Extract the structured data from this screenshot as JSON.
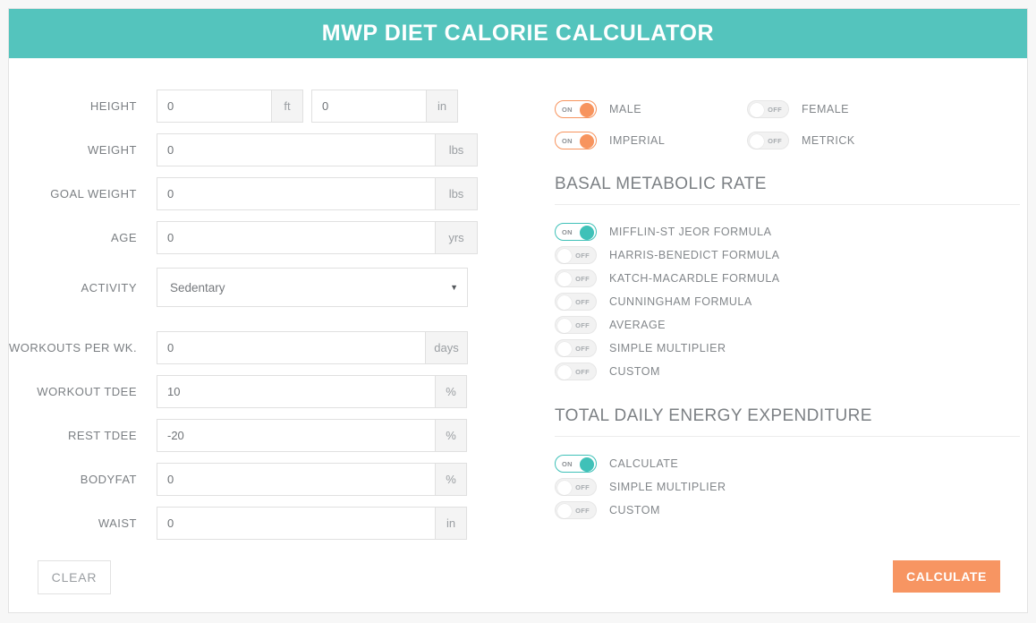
{
  "header": {
    "title": "MWP DIET CALORIE CALCULATOR"
  },
  "form": {
    "fields": [
      {
        "label": "HEIGHT",
        "value": "0",
        "suffix": "ft",
        "value2": "0",
        "suffix2": "in"
      },
      {
        "label": "WEIGHT",
        "value": "0",
        "suffix": "lbs"
      },
      {
        "label": "GOAL WEIGHT",
        "value": "0",
        "suffix": "lbs"
      },
      {
        "label": "AGE",
        "value": "0",
        "suffix": "yrs"
      },
      {
        "label": "ACTIVITY",
        "value": "Sedentary"
      },
      {
        "label": "WORKOUTS PER WK.",
        "value": "0",
        "suffix": "days"
      },
      {
        "label": "WORKOUT TDEE",
        "value": "10",
        "suffix": "%"
      },
      {
        "label": "REST TDEE",
        "value": "-20",
        "suffix": "%"
      },
      {
        "label": "BODYFAT",
        "value": "0",
        "suffix": "%"
      },
      {
        "label": "WAIST",
        "value": "0",
        "suffix": "in"
      }
    ],
    "activity_options": [
      "Sedentary"
    ],
    "select_arrow": "▼"
  },
  "toggles": {
    "on_text": "ON",
    "off_text": "OFF",
    "gender": [
      {
        "label": "MALE",
        "state": "on",
        "color": "#f7945e"
      },
      {
        "label": "FEMALE",
        "state": "off"
      }
    ],
    "units": [
      {
        "label": "IMPERIAL",
        "state": "on",
        "color": "#f7945e"
      },
      {
        "label": "METRICK",
        "state": "off"
      }
    ]
  },
  "bmr": {
    "heading": "BASAL METABOLIC RATE",
    "options": [
      {
        "label": "MIFFLIN-ST JEOR FORMULA",
        "state": "on",
        "color": "#3fc1b8"
      },
      {
        "label": "HARRIS-BENEDICT FORMULA",
        "state": "off"
      },
      {
        "label": "KATCH-MACARDLE FORMULA",
        "state": "off"
      },
      {
        "label": "CUNNINGHAM FORMULA",
        "state": "off"
      },
      {
        "label": "AVERAGE",
        "state": "off"
      },
      {
        "label": "SIMPLE MULTIPLIER",
        "state": "off"
      },
      {
        "label": "CUSTOM",
        "state": "off"
      }
    ]
  },
  "tdee": {
    "heading": "TOTAL DAILY ENERGY EXPENDITURE",
    "options": [
      {
        "label": "CALCULATE",
        "state": "on",
        "color": "#3fc1b8"
      },
      {
        "label": "SIMPLE MULTIPLIER",
        "state": "off"
      },
      {
        "label": "CUSTOM",
        "state": "off"
      }
    ]
  },
  "footer": {
    "clear_label": "CLEAR",
    "calculate_label": "CALCULATE"
  },
  "theme": {
    "header_teal": "#54c4bd",
    "accent_orange": "#f79562",
    "accent_teal": "#3fc1b8"
  }
}
